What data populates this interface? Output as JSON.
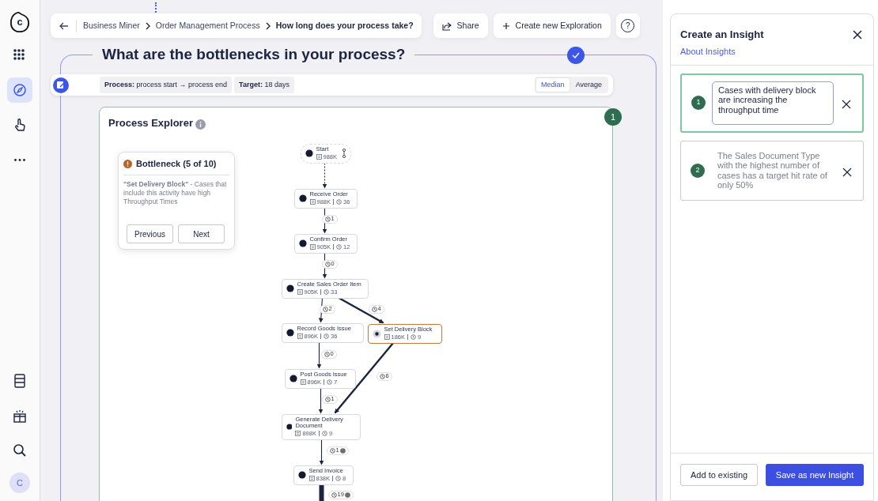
{
  "sidebar": {
    "logo_letter": "c",
    "nav": [
      {
        "selected": false
      },
      {
        "selected": true
      },
      {
        "selected": false
      },
      {
        "selected": false
      }
    ],
    "avatar": "C"
  },
  "breadcrumb": [
    {
      "label": "Business Miner",
      "current": false
    },
    {
      "label": "Order Management Process",
      "current": false
    },
    {
      "label": "How long does your process take?",
      "current": true
    }
  ],
  "actions": {
    "share": "Share",
    "create": "Create new Exploration",
    "help": "?"
  },
  "question": {
    "title": "What are the bottlenecks in your process?",
    "done": true
  },
  "process_bar": {
    "filters": [
      "**Process:** process start → process end",
      "**Target:** 18 days"
    ],
    "toggle": [
      {
        "label": "Median",
        "selected": true
      },
      {
        "label": "Average",
        "selected": false
      }
    ]
  },
  "explorer": {
    "title": "Process Explorer",
    "badge": "1",
    "bottleneck": {
      "title": "Bottleneck (5 of 10)",
      "text": "**\"Set Delivery Block\"** - Cases that include this activity have high Throughput Times",
      "previous": "Previous",
      "next": "Next"
    },
    "nodes": [
      {
        "name": "Start",
        "kind": "start",
        "cases": "988K",
        "selected": false
      },
      {
        "name": "Receive Order",
        "kind": "activity",
        "cases": "988K",
        "time": "36",
        "selected": false
      },
      {
        "name": "Confirm Order",
        "kind": "activity",
        "cases": "905K",
        "time": "12",
        "selected": false
      },
      {
        "name": "Create Sales Order Item",
        "kind": "activity",
        "cases": "905K",
        "time": "33",
        "selected": false
      },
      {
        "name": "Record Goods Issue",
        "kind": "activity",
        "cases": "896K",
        "time": "36",
        "selected": false
      },
      {
        "name": "Set Delivery Block",
        "kind": "activity",
        "cases": "186K",
        "time": "9",
        "selected": true
      },
      {
        "name": "Post Goods Issue",
        "kind": "activity",
        "cases": "896K",
        "time": "7",
        "selected": false
      },
      {
        "name": "Generate Delivery Document",
        "kind": "activity",
        "cases": "898K",
        "time": "9",
        "selected": false
      },
      {
        "name": "Send Invoice",
        "kind": "activity",
        "cases": "838K",
        "time": "8",
        "selected": false
      }
    ],
    "edges": [
      {
        "kind": "dashed"
      },
      {
        "kind": "thin",
        "duration": "1",
        "flagged": false
      },
      {
        "kind": "thin",
        "duration": "0",
        "flagged": false
      },
      {
        "kind": "thin",
        "duration": "2",
        "flagged": false
      },
      {
        "kind": "thick",
        "duration": "4",
        "flagged": false
      },
      {
        "kind": "thin",
        "duration": "0",
        "flagged": false
      },
      {
        "kind": "thick",
        "duration": "6",
        "flagged": false
      },
      {
        "kind": "thin",
        "duration": "1",
        "flagged": false
      },
      {
        "kind": "thin",
        "duration": "1",
        "flagged": true
      },
      {
        "kind": "heavy",
        "duration": "19",
        "flagged": true
      }
    ]
  },
  "insight_panel": {
    "title": "Create an Insight",
    "link": "About Insights",
    "insights": [
      {
        "number": "1",
        "text": "Cases with delivery block are increasing the throughput time",
        "editing": true
      },
      {
        "number": "2",
        "text": "The Sales Document Type with the highest number of cases has a target hit rate of only 50%",
        "editing": false
      }
    ],
    "add": "Add to existing",
    "save": "Save as new Insight"
  }
}
